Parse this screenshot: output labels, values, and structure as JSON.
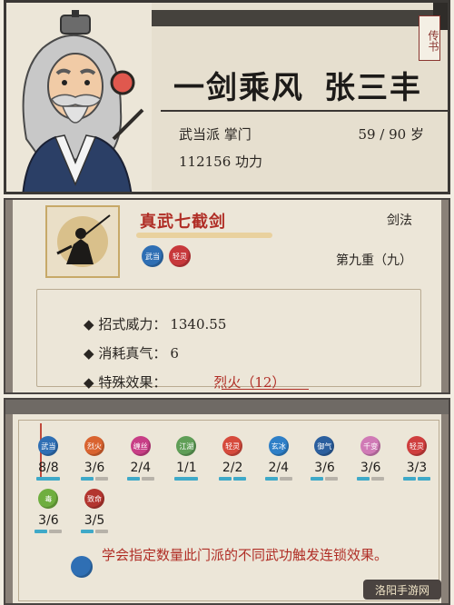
{
  "character": {
    "tag": "传书",
    "epithet": "一剑乘风",
    "name": "张三丰",
    "sect_role": "武当派 掌门",
    "age": "59 / 90 岁",
    "power": "112156 功力"
  },
  "skill": {
    "name": "真武七截剑",
    "type": "剑法",
    "level": "第九重（九）",
    "chips": [
      {
        "label": "武当",
        "color": "#2f6fb4"
      },
      {
        "label": "轻灵",
        "color": "#c7383b"
      }
    ],
    "stats": [
      {
        "label": "招式威力：",
        "value": "1340.55"
      },
      {
        "label": "消耗真气：",
        "value": "6"
      },
      {
        "label": "特殊效果：",
        "value": "烈火（12）"
      }
    ]
  },
  "combo": {
    "items": [
      {
        "label": "武当",
        "color": "#2f6fb4",
        "count": "8/8",
        "on": 1,
        "total": 1
      },
      {
        "label": "烈火",
        "color": "#d9632f",
        "count": "3/6",
        "on": 1,
        "total": 2
      },
      {
        "label": "缠丝",
        "color": "#c83e86",
        "count": "2/4",
        "on": 1,
        "total": 2
      },
      {
        "label": "江湖",
        "color": "#5f9e57",
        "count": "1/1",
        "on": 1,
        "total": 1
      },
      {
        "label": "轻灵",
        "color": "#d64a3c",
        "count": "2/2",
        "on": 2,
        "total": 2
      },
      {
        "label": "玄冰",
        "color": "#2e7fc7",
        "count": "2/4",
        "on": 1,
        "total": 2
      },
      {
        "label": "御气",
        "color": "#2b5f9e",
        "count": "3/6",
        "on": 1,
        "total": 2
      },
      {
        "label": "千变",
        "color": "#d07ab6",
        "count": "3/6",
        "on": 1,
        "total": 2
      },
      {
        "label": "轻灵",
        "color": "#cf3e3e",
        "count": "3/3",
        "on": 2,
        "total": 2
      },
      {
        "label": "毒",
        "color": "#6fae3f",
        "count": "3/6",
        "on": 1,
        "total": 2
      },
      {
        "label": "致命",
        "color": "#b3352f",
        "count": "3/5",
        "on": 1,
        "total": 2
      }
    ],
    "note": "学会指定数量此门派的不同武功触发连锁效果。",
    "watermark": "洛阳手游网"
  }
}
